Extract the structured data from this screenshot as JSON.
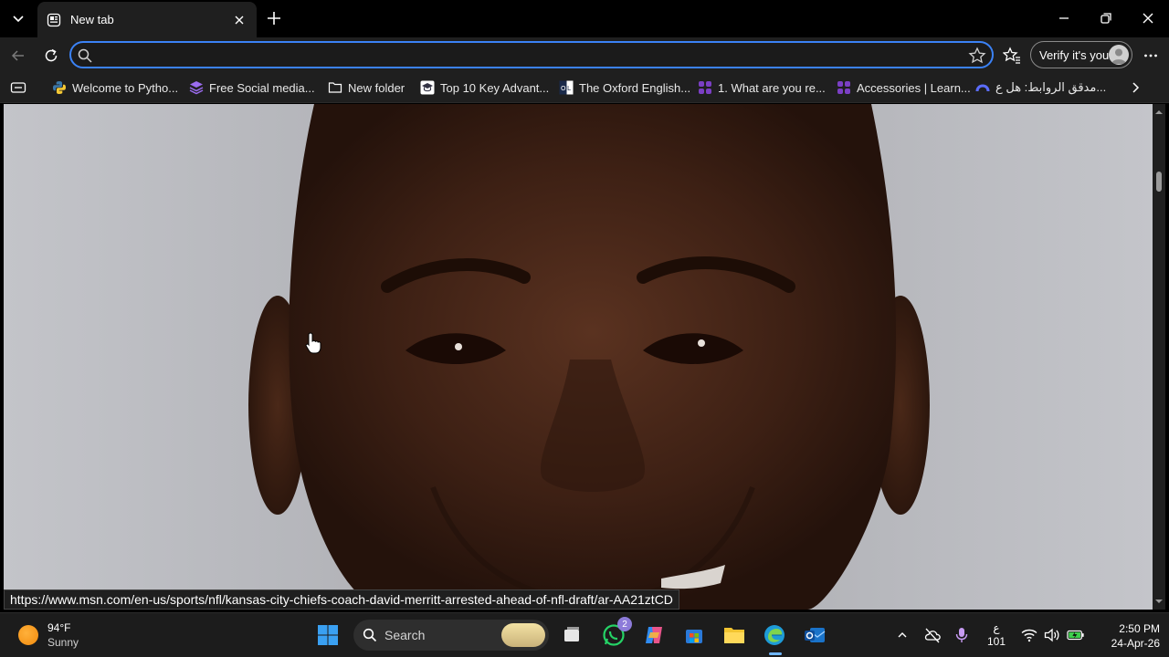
{
  "browser": {
    "tab": {
      "title": "New tab"
    },
    "address": {
      "value": "",
      "placeholder": ""
    },
    "profile": {
      "label": "Verify it's you"
    }
  },
  "favorites": [
    {
      "label": "Welcome to Pytho...",
      "icon": "python-icon"
    },
    {
      "label": "Free Social media...",
      "icon": "layers-icon"
    },
    {
      "label": "New folder",
      "icon": "folder-icon"
    },
    {
      "label": "Top 10 Key Advant...",
      "icon": "graduation-cap-icon"
    },
    {
      "label": "The Oxford English...",
      "icon": "oxford-icon"
    },
    {
      "label": "1. What are you re...",
      "icon": "grid-icon"
    },
    {
      "label": "Accessories | Learn...",
      "icon": "grid-icon"
    },
    {
      "label": "مدقق الروابط: هل ع...",
      "icon": "arc-icon"
    }
  ],
  "content": {
    "status_url": "https://www.msn.com/en-us/sports/nfl/kansas-city-chiefs-coach-david-merritt-arrested-ahead-of-nfl-draft/ar-AA21ztCD"
  },
  "taskbar": {
    "weather": {
      "temp": "94°F",
      "condition": "Sunny"
    },
    "search_label": "Search",
    "whatsapp_badge": "2",
    "language": {
      "top": "ع",
      "bottom": "101"
    },
    "clock": {
      "time": "2:50 PM",
      "date": "24-Apr-26"
    }
  },
  "colors": {
    "accent": "#3b82f6",
    "badge": "#8d7bd9",
    "active": "#6fb6ff"
  }
}
